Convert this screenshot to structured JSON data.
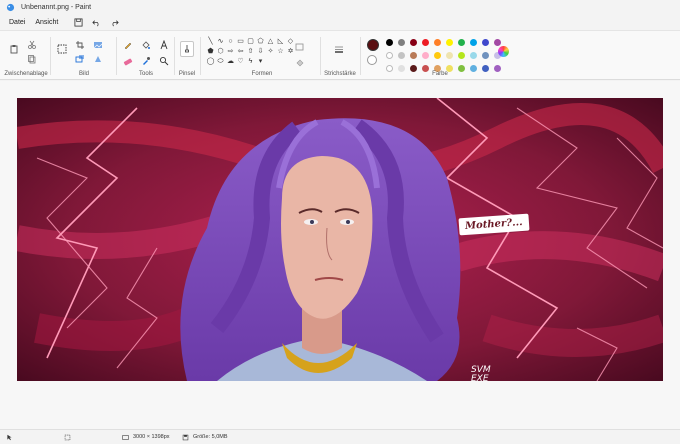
{
  "window": {
    "title": "Unbenannt.png - Paint"
  },
  "menu": {
    "file": "Datei",
    "view": "Ansicht"
  },
  "ribbon": {
    "groups": {
      "clipboard": "Zwischenablage",
      "image": "Bild",
      "tools": "Tools",
      "brushes": "Pinsel",
      "shapes": "Formen",
      "stroke": "Strichstärke",
      "colors": "Farbe"
    },
    "colors": {
      "primary": "#5a0f12",
      "secondary": "#ffffff",
      "palette": [
        "#000000",
        "#7f7f7f",
        "#880015",
        "#ed1c24",
        "#ff7f27",
        "#fff200",
        "#22b14c",
        "#00a2e8",
        "#3f48cc",
        "#a349a4",
        "#ffffff",
        "#c3c3c3",
        "#b97a57",
        "#ffaec9",
        "#ffc90e",
        "#efe4b0",
        "#b5e61d",
        "#99d9ea",
        "#7092be",
        "#c8bfe7",
        "#ffffff",
        "#e0e0e0",
        "#5a1a1a",
        "#c85050",
        "#e0a060",
        "#f0e060",
        "#80c040",
        "#60b0e0",
        "#4060c0",
        "#a060c0"
      ]
    }
  },
  "artwork": {
    "speech_text": "Mother?...",
    "signature": "SVM\nEXE",
    "colors": {
      "background": "#6b0f2c",
      "hair": "#7a4bb3",
      "skin": "#e9b6a6",
      "collar": "#d6a21c",
      "lightning": "#ff8fb0"
    }
  },
  "status": {
    "dimensions": "3000 × 1398px",
    "size": "Größe: 5,0MB"
  }
}
